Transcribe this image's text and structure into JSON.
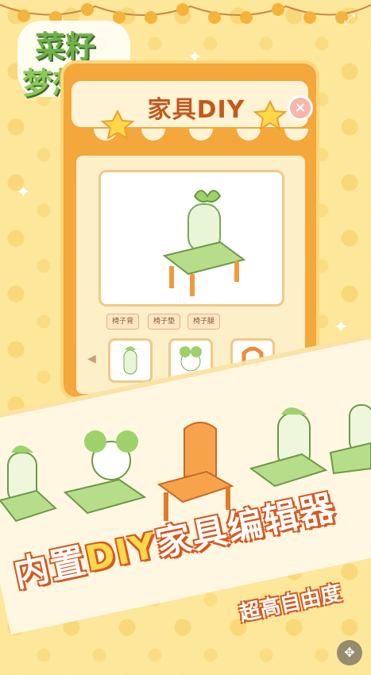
{
  "logo": {
    "line1": "菜籽",
    "line2": "梦想家"
  },
  "panel": {
    "title": "家具DIY",
    "close_label": "×",
    "tags": [
      "椅子背",
      "椅子垫",
      "椅子腿"
    ],
    "prev_label": "◀",
    "next_label": "▶"
  },
  "banner": {
    "slogan_part1": "内置",
    "slogan_highlight": "DIY",
    "slogan_part2": "家具编辑器",
    "subslogan": "超高自由度"
  },
  "controls": {
    "corner_label": "⤢",
    "bottom_label": "✥"
  },
  "colors": {
    "accent": "#f4a73b",
    "text_title": "#c25a1e",
    "chair_green": "#a8d47a",
    "chair_orange": "#f08a3a"
  }
}
